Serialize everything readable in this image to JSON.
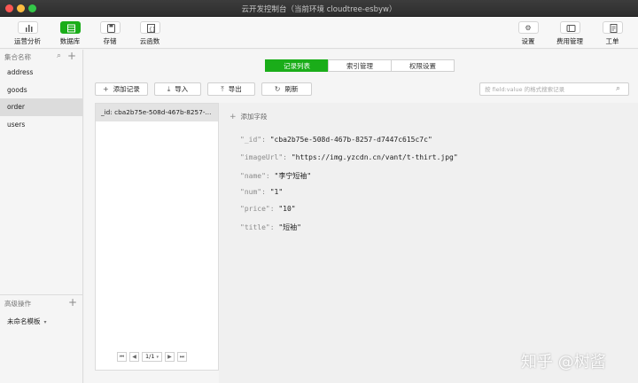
{
  "window": {
    "title": "云开发控制台（当前环境 cloudtree-esbyw）"
  },
  "toolbar": {
    "left": [
      {
        "label": "运营分析",
        "icon": "bar-chart-icon",
        "active": false
      },
      {
        "label": "数据库",
        "icon": "database-icon",
        "active": true
      },
      {
        "label": "存储",
        "icon": "storage-icon",
        "active": false
      },
      {
        "label": "云函数",
        "icon": "cloud-function-icon",
        "active": false
      }
    ],
    "right": [
      {
        "label": "设置",
        "icon": "gear-icon"
      },
      {
        "label": "费用管理",
        "icon": "billing-icon"
      },
      {
        "label": "工单",
        "icon": "ticket-icon"
      }
    ]
  },
  "sidebar": {
    "header": "集合名称",
    "collections": [
      "address",
      "goods",
      "order",
      "users"
    ],
    "selected": "order",
    "advanced_label": "高级操作",
    "template_label": "未命名模板"
  },
  "tabs": [
    "记录列表",
    "索引管理",
    "权限设置"
  ],
  "active_tab": "记录列表",
  "actions": {
    "add_record": "添加记录",
    "import": "导入",
    "export": "导出",
    "refresh": "刷新"
  },
  "search": {
    "placeholder": "按 field:value 的格式搜索记录",
    "value": ""
  },
  "records": [
    "_id: cba2b75e-508d-467b-8257-..."
  ],
  "pagination": {
    "page": "1/1"
  },
  "detail": {
    "add_field": "添加字段",
    "fields": [
      {
        "key": "\"_id\"",
        "value": "\"cba2b75e-508d-467b-8257-d7447c615c7c\""
      },
      {
        "key": "\"imageUrl\"",
        "value": "\"https://img.yzcdn.cn/vant/t-thirt.jpg\""
      },
      {
        "key": "\"name\"",
        "value": "\"李宁短袖\""
      },
      {
        "key": "\"num\"",
        "value": "\"1\""
      },
      {
        "key": "\"price\"",
        "value": "\"10\""
      },
      {
        "key": "\"title\"",
        "value": "\"短袖\""
      }
    ]
  },
  "watermark": "知乎 @树酱",
  "colors": {
    "accent": "#1aad19",
    "selected_row": "#e3e3e3"
  }
}
